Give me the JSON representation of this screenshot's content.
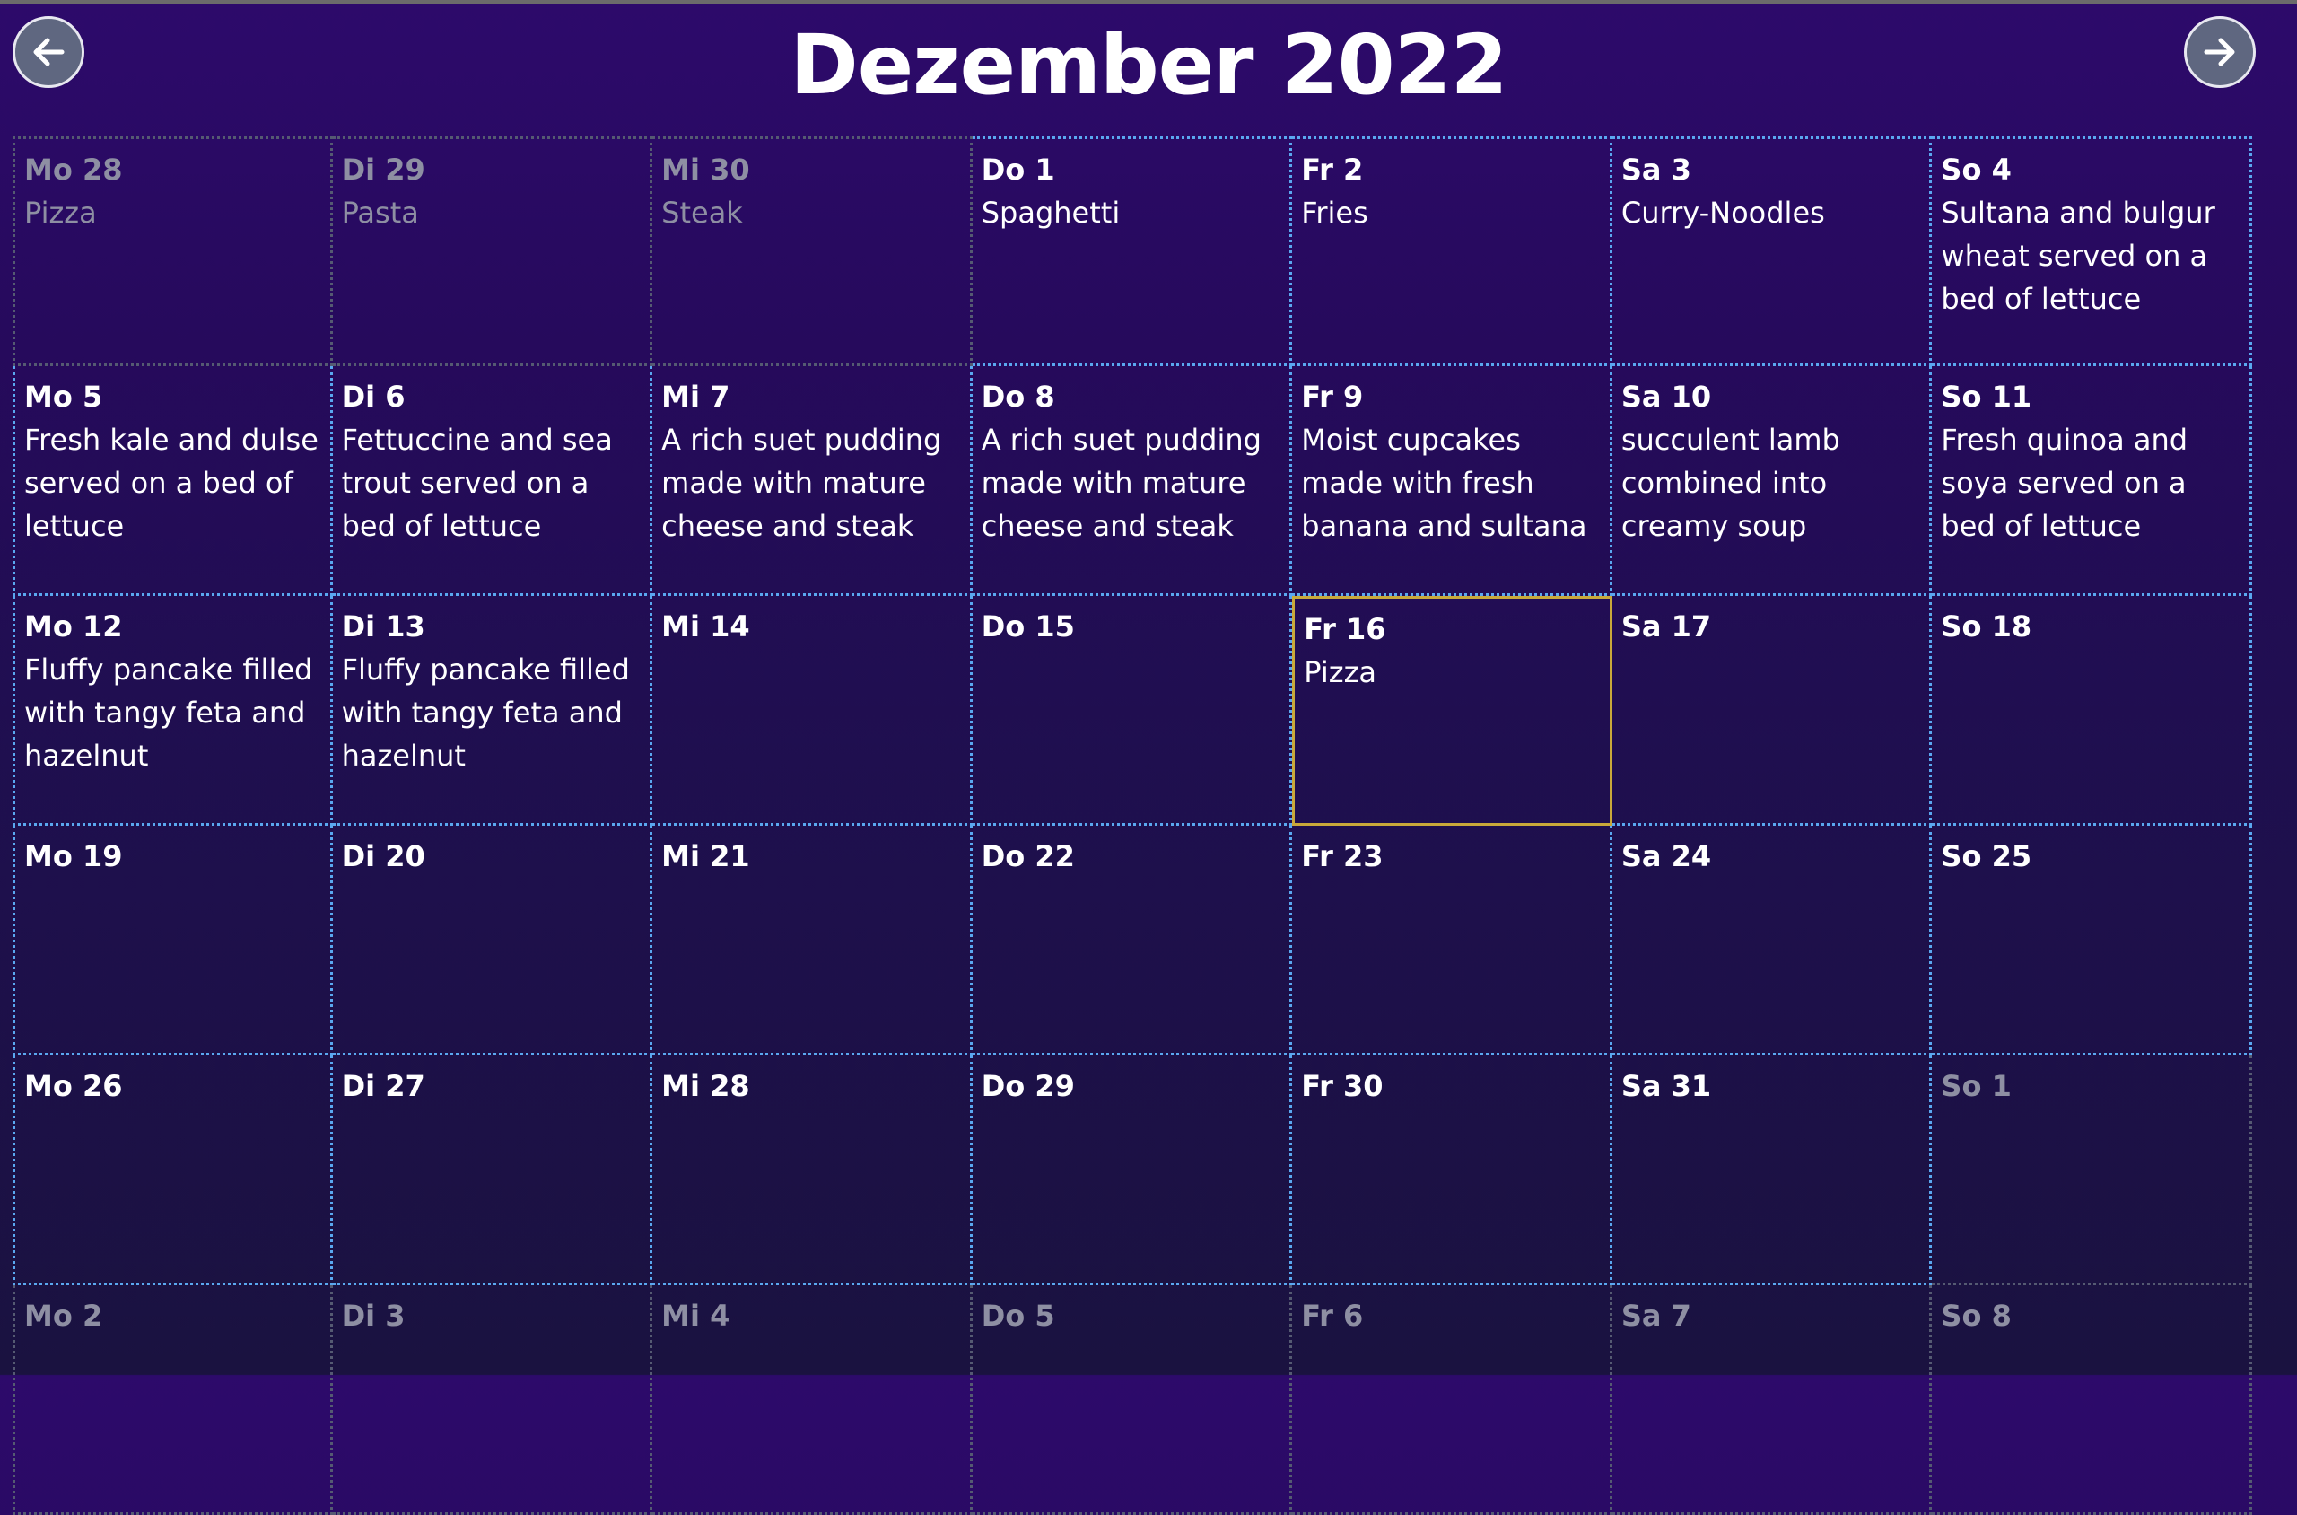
{
  "calendar": {
    "title": "Dezember 2022",
    "prev_icon": "arrow-left-icon",
    "next_icon": "arrow-right-icon",
    "colors": {
      "bg_top": "#2d0a6b",
      "bg_bottom": "#1a1240",
      "grid_line": "#5aa8f0",
      "today_border": "#c9a93a",
      "muted_text": "#8e8fa3"
    },
    "cells": [
      {
        "day": "Mo 28",
        "meal": "Pizza",
        "muted": true
      },
      {
        "day": "Di 29",
        "meal": "Pasta",
        "muted": true
      },
      {
        "day": "Mi 30",
        "meal": "Steak",
        "muted": true
      },
      {
        "day": "Do 1",
        "meal": "Spaghetti"
      },
      {
        "day": "Fr 2",
        "meal": "Fries"
      },
      {
        "day": "Sa 3",
        "meal": "Curry-Noodles"
      },
      {
        "day": "So 4",
        "meal": "Sultana and bulgur wheat served on a bed of lettuce"
      },
      {
        "day": "Mo 5",
        "meal": "Fresh kale and dulse served on a bed of lettuce"
      },
      {
        "day": "Di 6",
        "meal": "Fettuccine and sea trout served on a bed of lettuce"
      },
      {
        "day": "Mi 7",
        "meal": "A rich suet pudding made with mature cheese and steak"
      },
      {
        "day": "Do 8",
        "meal": "A rich suet pudding made with mature cheese and steak"
      },
      {
        "day": "Fr 9",
        "meal": "Moist cupcakes made with fresh banana and sultana"
      },
      {
        "day": "Sa 10",
        "meal": "succulent lamb combined into creamy soup"
      },
      {
        "day": "So 11",
        "meal": "Fresh quinoa and soya served on a bed of lettuce"
      },
      {
        "day": "Mo 12",
        "meal": "Fluffy pancake filled with tangy feta and hazelnut"
      },
      {
        "day": "Di 13",
        "meal": "Fluffy pancake filled with tangy feta and hazelnut"
      },
      {
        "day": "Mi 14",
        "meal": ""
      },
      {
        "day": "Do 15",
        "meal": ""
      },
      {
        "day": "Fr 16",
        "meal": "Pizza",
        "today": true
      },
      {
        "day": "Sa 17",
        "meal": ""
      },
      {
        "day": "So 18",
        "meal": ""
      },
      {
        "day": "Mo 19",
        "meal": ""
      },
      {
        "day": "Di 20",
        "meal": ""
      },
      {
        "day": "Mi 21",
        "meal": ""
      },
      {
        "day": "Do 22",
        "meal": ""
      },
      {
        "day": "Fr 23",
        "meal": ""
      },
      {
        "day": "Sa 24",
        "meal": ""
      },
      {
        "day": "So 25",
        "meal": ""
      },
      {
        "day": "Mo 26",
        "meal": ""
      },
      {
        "day": "Di 27",
        "meal": ""
      },
      {
        "day": "Mi 28",
        "meal": ""
      },
      {
        "day": "Do 29",
        "meal": ""
      },
      {
        "day": "Fr 30",
        "meal": ""
      },
      {
        "day": "Sa 31",
        "meal": ""
      },
      {
        "day": "So 1",
        "meal": "",
        "muted": true
      },
      {
        "day": "Mo 2",
        "meal": "",
        "muted": true
      },
      {
        "day": "Di 3",
        "meal": "",
        "muted": true
      },
      {
        "day": "Mi 4",
        "meal": "",
        "muted": true
      },
      {
        "day": "Do 5",
        "meal": "",
        "muted": true
      },
      {
        "day": "Fr 6",
        "meal": "",
        "muted": true
      },
      {
        "day": "Sa 7",
        "meal": "",
        "muted": true
      },
      {
        "day": "So 8",
        "meal": "",
        "muted": true
      }
    ]
  }
}
